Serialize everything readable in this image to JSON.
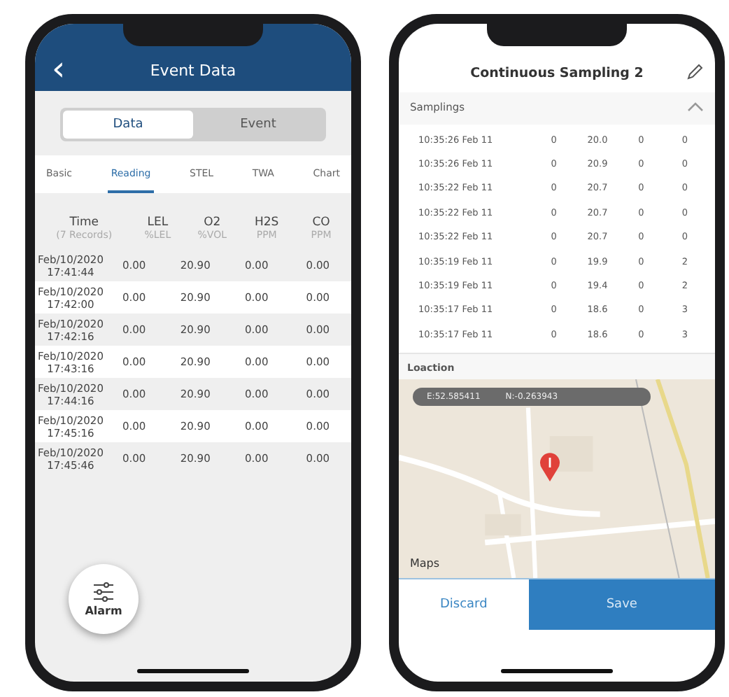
{
  "phones": [
    {
      "kind": "event",
      "header": {
        "back": "‹",
        "title": "Event Data"
      },
      "segments": [
        {
          "label": "Data",
          "selected": true
        },
        {
          "label": "Event",
          "selected": false
        }
      ],
      "tabs": [
        {
          "label": "Basic",
          "selected": false
        },
        {
          "label": "Reading",
          "selected": true
        },
        {
          "label": "STEL",
          "selected": false
        },
        {
          "label": "TWA",
          "selected": false
        },
        {
          "label": "Chart",
          "selected": false
        }
      ],
      "table": {
        "columns": [
          {
            "name": "Time",
            "unit": "(7 Records)"
          },
          {
            "name": "LEL",
            "unit": "%LEL"
          },
          {
            "name": "O2",
            "unit": "%VOL"
          },
          {
            "name": "H2S",
            "unit": "PPM"
          },
          {
            "name": "CO",
            "unit": "PPM"
          }
        ],
        "rows": [
          {
            "date": "Feb/10/2020",
            "time": "17:41:44",
            "values": [
              "0.00",
              "20.90",
              "0.00",
              "0.00"
            ]
          },
          {
            "date": "Feb/10/2020",
            "time": "17:42:00",
            "values": [
              "0.00",
              "20.90",
              "0.00",
              "0.00"
            ]
          },
          {
            "date": "Feb/10/2020",
            "time": "17:42:16",
            "values": [
              "0.00",
              "20.90",
              "0.00",
              "0.00"
            ]
          },
          {
            "date": "Feb/10/2020",
            "time": "17:43:16",
            "values": [
              "0.00",
              "20.90",
              "0.00",
              "0.00"
            ]
          },
          {
            "date": "Feb/10/2020",
            "time": "17:44:16",
            "values": [
              "0.00",
              "20.90",
              "0.00",
              "0.00"
            ]
          },
          {
            "date": "Feb/10/2020",
            "time": "17:45:16",
            "values": [
              "0.00",
              "20.90",
              "0.00",
              "0.00"
            ]
          },
          {
            "date": "Feb/10/2020",
            "time": "17:45:46",
            "values": [
              "0.00",
              "20.90",
              "0.00",
              "0.00"
            ]
          }
        ]
      },
      "fab": {
        "label": "Alarm"
      }
    },
    {
      "kind": "sampling",
      "title": "Continuous Sampling 2",
      "section": {
        "label": "Samplings",
        "expanded": true
      },
      "rows": [
        [
          "10:35:26 Feb 11",
          "0",
          "20.0",
          "0",
          "0"
        ],
        [
          "10:35:26 Feb 11",
          "0",
          "20.9",
          "0",
          "0"
        ],
        [
          "10:35:22 Feb 11",
          "0",
          "20.7",
          "0",
          "0"
        ],
        [
          "10:35:22 Feb 11",
          "0",
          "20.7",
          "0",
          "0"
        ],
        [
          "10:35:22 Feb 11",
          "0",
          "20.7",
          "0",
          "0"
        ],
        [
          "10:35:19 Feb 11",
          "0",
          "19.9",
          "0",
          "2"
        ],
        [
          "10:35:19 Feb 11",
          "0",
          "19.4",
          "0",
          "2"
        ],
        [
          "10:35:17 Feb 11",
          "0",
          "18.6",
          "0",
          "3"
        ],
        [
          "10:35:17 Feb 11",
          "0",
          "18.6",
          "0",
          "3"
        ]
      ],
      "location": {
        "label": "Loaction",
        "easting": "E:52.585411",
        "northing": "N:-0.263943",
        "attribution": "Maps"
      },
      "buttons": [
        {
          "label": "Discard",
          "kind": "secondary"
        },
        {
          "label": "Save",
          "kind": "primary"
        }
      ]
    }
  ]
}
